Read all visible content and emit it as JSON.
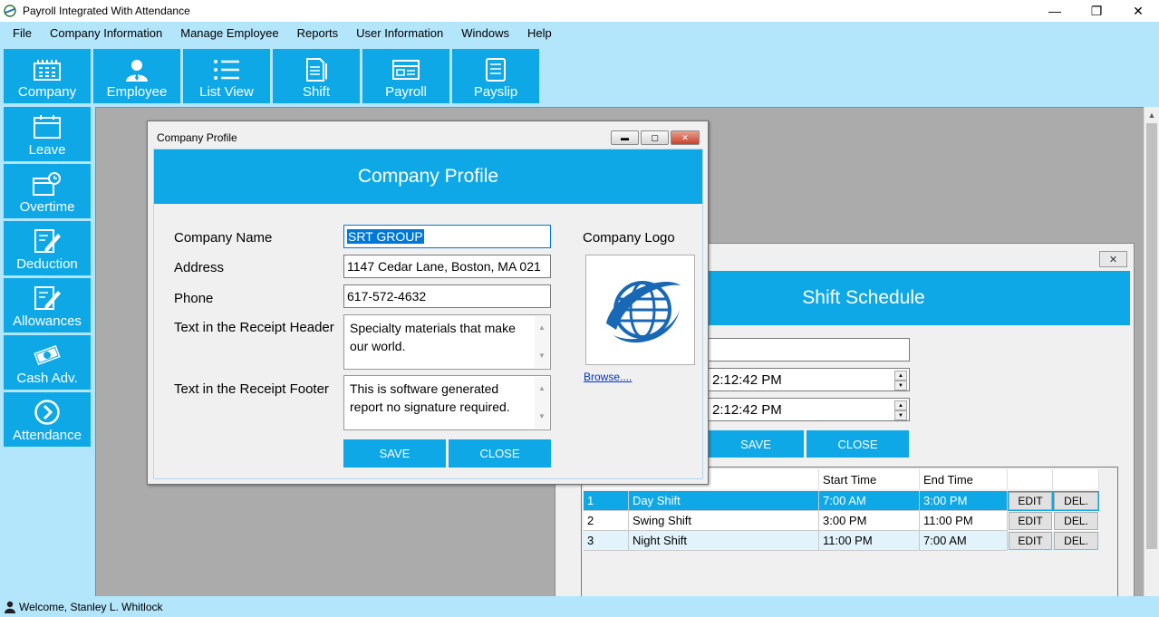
{
  "window": {
    "title": "Payroll Integrated With Attendance"
  },
  "menu": [
    "File",
    "Company Information",
    "Manage Employee",
    "Reports",
    "User Information",
    "Windows",
    "Help"
  ],
  "toolbar": [
    {
      "label": "Company",
      "icon": "building-icon"
    },
    {
      "label": "Employee",
      "icon": "person-icon"
    },
    {
      "label": "List View",
      "icon": "list-icon"
    },
    {
      "label": "Shift",
      "icon": "document-pen-icon"
    },
    {
      "label": "Payroll",
      "icon": "payroll-icon"
    },
    {
      "label": "Payslip",
      "icon": "payslip-icon"
    }
  ],
  "sidebar": [
    {
      "label": "Leave",
      "icon": "calendar-icon"
    },
    {
      "label": "Overtime",
      "icon": "clock-calendar-icon"
    },
    {
      "label": "Deduction",
      "icon": "edit-document-icon"
    },
    {
      "label": "Allowances",
      "icon": "edit-document-icon"
    },
    {
      "label": "Cash Adv.",
      "icon": "cash-icon"
    },
    {
      "label": "Attendance",
      "icon": "chevron-circle-icon"
    }
  ],
  "company_profile": {
    "window_title": "Company Profile",
    "header": "Company Profile",
    "labels": {
      "name": "Company Name",
      "address": "Address",
      "phone": "Phone",
      "header_text": "Text in the Receipt Header",
      "footer_text": "Text in the Receipt Footer",
      "logo": "Company Logo"
    },
    "values": {
      "name": "SRT GROUP",
      "address": "1147 Cedar Lane, Boston, MA 021",
      "phone": "617-572-4632",
      "header_text": "Specialty materials that make our world.",
      "footer_text": "This is software generated report no signature required."
    },
    "browse": "Browse....",
    "save": "SAVE",
    "close": "CLOSE"
  },
  "shift_schedule": {
    "header": "Shift Schedule",
    "close_glyph": "✕",
    "start_time": "2:12:42 PM",
    "end_time": "2:12:42 PM",
    "save": "SAVE",
    "close": "CLOSE",
    "columns": [
      "Start Time",
      "End Time"
    ],
    "rows": [
      {
        "no": "1",
        "name": "Day Shift",
        "start": "7:00 AM",
        "end": "3:00 PM"
      },
      {
        "no": "2",
        "name": "Swing Shift",
        "start": "3:00 PM",
        "end": "11:00 PM"
      },
      {
        "no": "3",
        "name": "Night Shift",
        "start": "11:00 PM",
        "end": "7:00 AM"
      }
    ],
    "edit": "EDIT",
    "del": "DEL."
  },
  "status": {
    "welcome": "Welcome, Stanley L. Whitlock"
  },
  "colors": {
    "accent": "#0ea8e6",
    "background": "#b3e5fb",
    "mdi": "#ababab"
  }
}
